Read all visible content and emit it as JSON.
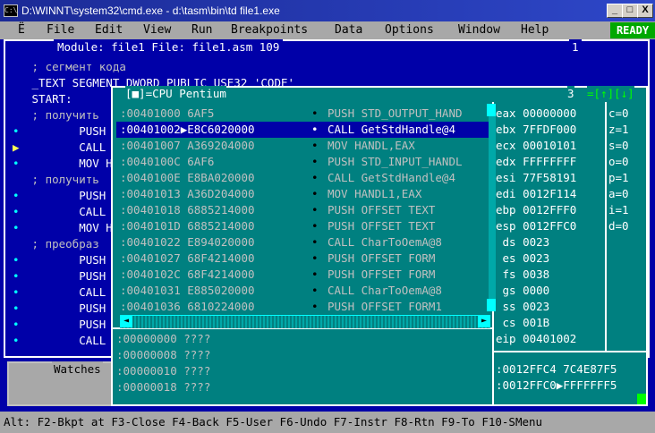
{
  "window": {
    "title": "D:\\WINNT\\system32\\cmd.exe - d:\\tasm\\bin\\td file1.exe",
    "icon_label": "C:\\",
    "minimize": "_",
    "maximize": "□",
    "close": "X"
  },
  "menu": {
    "system": "Ë",
    "items": [
      "File",
      "Edit",
      "View",
      "Run",
      "Breakpoints",
      "Data",
      "Options",
      "Window",
      "Help"
    ],
    "status": "READY"
  },
  "module": {
    "header": "Module: file1 File: file1.asm 109",
    "number": "1",
    "lines": [
      {
        "text": " ; сегмент кода",
        "color": "#c0c0c0"
      },
      {
        "text": " _TEXT SEGMENT DWORD PUBLIC USE32 'CODE'",
        "color": "#ffffff"
      },
      {
        "text": " START:",
        "color": "#ffffff"
      },
      {
        "text": " ; получить",
        "color": "#c0c0c0"
      },
      {
        "text": "        PUSH",
        "color": "#ffffff"
      },
      {
        "text": "        CALL",
        "color": "#ffffff"
      },
      {
        "text": "        MOV H",
        "color": "#ffffff"
      },
      {
        "text": " ; получить",
        "color": "#c0c0c0"
      },
      {
        "text": "        PUSH",
        "color": "#ffffff"
      },
      {
        "text": "        CALL",
        "color": "#ffffff"
      },
      {
        "text": "        MOV H",
        "color": "#ffffff"
      },
      {
        "text": " ; преобраз",
        "color": "#c0c0c0"
      },
      {
        "text": "        PUSH",
        "color": "#ffffff"
      },
      {
        "text": "        PUSH",
        "color": "#ffffff"
      },
      {
        "text": "        CALL",
        "color": "#ffffff"
      },
      {
        "text": "        PUSH",
        "color": "#ffffff"
      },
      {
        "text": "        PUSH",
        "color": "#ffffff"
      },
      {
        "text": "        CALL",
        "color": "#ffffff"
      }
    ],
    "markers": [
      "",
      "",
      "",
      "",
      "•",
      "▶",
      "•",
      "",
      "•",
      "•",
      "•",
      "",
      "•",
      "•",
      "•",
      "•",
      "•",
      "•"
    ]
  },
  "watches": {
    "label": "Watches"
  },
  "cpu": {
    "header": "[■]=CPU Pentium",
    "number": "3",
    "arrows": "=[↑][↓]",
    "code": [
      {
        "addr": ":00401000 6AF5",
        "instr": "PUSH STD_OUTPUT_HAND"
      },
      {
        "addr": ":00401002▶E8C6020000",
        "instr": "CALL GetStdHandle@4"
      },
      {
        "addr": ":00401007 A369204000",
        "instr": "MOV HANDL,EAX"
      },
      {
        "addr": ":0040100C 6AF6",
        "instr": "PUSH STD_INPUT_HANDL"
      },
      {
        "addr": ":0040100E E8BA020000",
        "instr": "CALL GetStdHandle@4"
      },
      {
        "addr": ":00401013 A36D204000",
        "instr": "MOV HANDL1,EAX"
      },
      {
        "addr": ":00401018 6885214000",
        "instr": "PUSH OFFSET TEXT"
      },
      {
        "addr": ":0040101D 6885214000",
        "instr": "PUSH OFFSET TEXT"
      },
      {
        "addr": ":00401022 E894020000",
        "instr": "CALL CharToOemA@8"
      },
      {
        "addr": ":00401027 68F4214000",
        "instr": "PUSH OFFSET FORM"
      },
      {
        "addr": ":0040102C 68F4214000",
        "instr": "PUSH OFFSET FORM"
      },
      {
        "addr": ":00401031 E885020000",
        "instr": "CALL CharToOemA@8"
      },
      {
        "addr": ":00401036 6810224000",
        "instr": "PUSH OFFSET FORM1"
      }
    ],
    "bullet": "•",
    "registers": [
      "eax 00000000",
      "ebx 7FFDF000",
      "ecx 00010101",
      "edx FFFFFFFF",
      "esi 77F58191",
      "edi 0012F114",
      "ebp 0012FFF0",
      "esp 0012FFC0",
      " ds 0023",
      " es 0023",
      " fs 0038",
      " gs 0000",
      " ss 0023",
      " cs 001B",
      "eip 00401002"
    ],
    "flags": [
      "c=0",
      "z=1",
      "s=0",
      "o=0",
      "p=1",
      "a=0",
      "i=1",
      "d=0"
    ],
    "dump": [
      ":00000000 ????",
      ":00000008 ????",
      ":00000010 ????",
      ":00000018 ????"
    ],
    "stack": [
      ":0012FFC4 7C4E87F5",
      ":0012FFC0▶FFFFFFF5"
    ]
  },
  "statusbar": "Alt: F2-Bkpt at F3-Close F4-Back F5-User F6-Undo F7-Instr F8-Rtn F9-To F10-SMenu"
}
